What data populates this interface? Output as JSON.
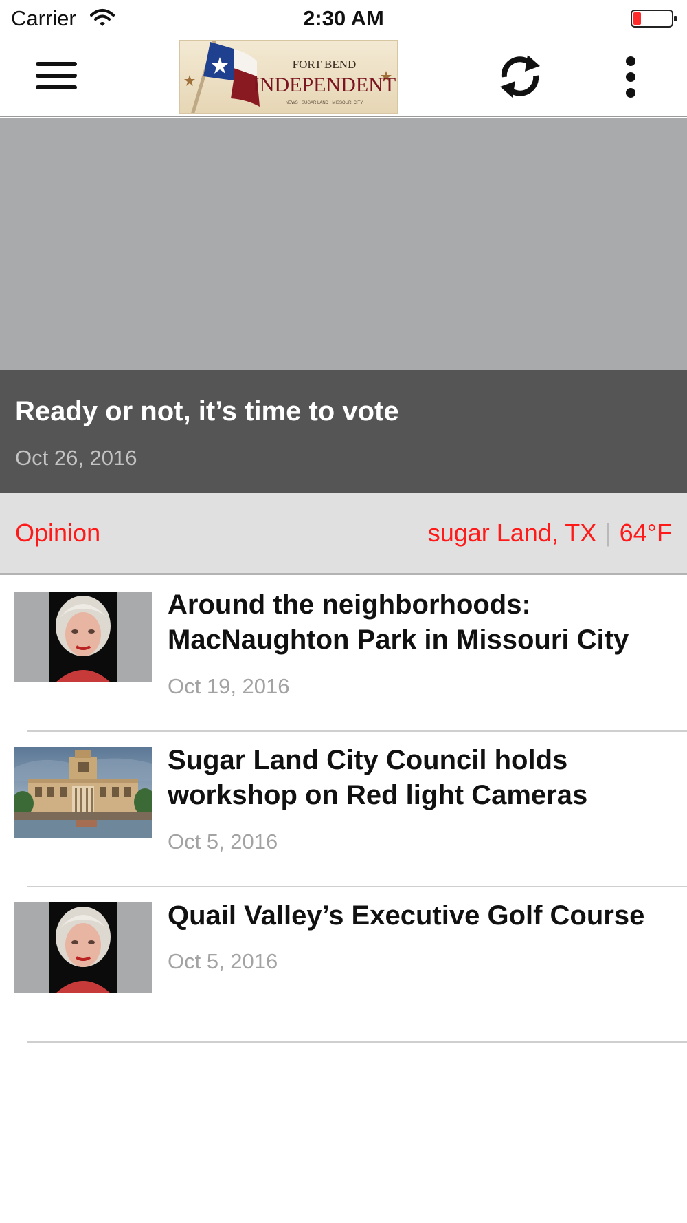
{
  "status_bar": {
    "carrier": "Carrier",
    "time": "2:30 AM",
    "battery_color": "#ff2a2a"
  },
  "nav_bar": {
    "menu_icon": "hamburger-icon",
    "logo": {
      "line1": "FORT BEND",
      "line2": "INDEPENDENT",
      "tagline": "NEWS · SUGAR LAND · MISSOURI CITY"
    },
    "refresh_icon": "refresh-icon",
    "more_icon": "more-vertical-icon"
  },
  "hero": {
    "title": "Ready or not, it’s time to vote",
    "date": "Oct 26, 2016"
  },
  "category_bar": {
    "category": "Opinion",
    "location": "sugar Land, TX",
    "separator": "|",
    "temperature": "64°F",
    "accent_color": "#ff1a1a"
  },
  "articles": [
    {
      "title": "Around the neighborhoods: MacNaughton Park in Missouri City",
      "date": "Oct 19, 2016",
      "thumbnail": "portrait"
    },
    {
      "title": "Sugar Land City Council holds workshop on Red light Cameras",
      "date": "Oct 5, 2016",
      "thumbnail": "city-hall"
    },
    {
      "title": "Quail Valley’s Executive Golf Course",
      "date": "Oct 5, 2016",
      "thumbnail": "portrait"
    }
  ]
}
